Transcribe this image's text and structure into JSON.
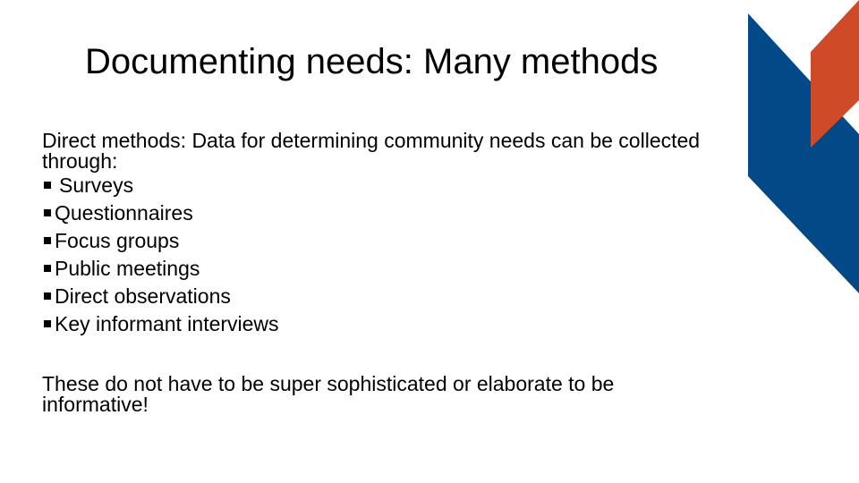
{
  "slide": {
    "title": "Documenting needs: Many methods",
    "intro": "Direct methods: Data for determining community needs can be collected through:",
    "methods": [
      "Surveys",
      "Questionnaires",
      "Focus groups",
      "Public meetings",
      "Direct observations",
      "Key informant interviews"
    ],
    "note": "These do not have to be super sophisticated or elaborate to be informative!",
    "bullet_icon": "square-bullet-icon"
  },
  "colors": {
    "accent_blue": "#014a87",
    "accent_orange": "#cf4b28",
    "text": "#000000",
    "background": "#ffffff"
  }
}
